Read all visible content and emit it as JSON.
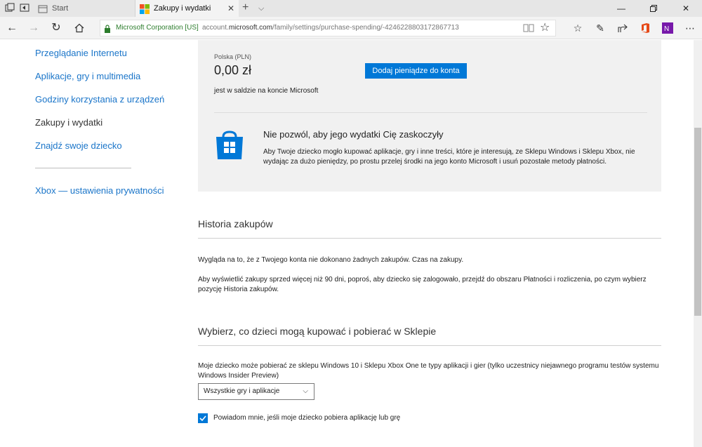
{
  "tabs": [
    {
      "label": "Start"
    },
    {
      "label": "Zakupy i wydatki"
    }
  ],
  "address": {
    "company": "Microsoft Corporation [US]",
    "url_prefix": "account.",
    "url_domain": "microsoft.com",
    "url_path": "/family/settings/purchase-spending/-4246228803172867713"
  },
  "sidebar": {
    "items": [
      {
        "label": "Przeglądanie Internetu"
      },
      {
        "label": "Aplikacje, gry i multimedia"
      },
      {
        "label": "Godziny korzystania z urządzeń"
      },
      {
        "label": "Zakupy i wydatki"
      },
      {
        "label": "Znajdź swoje dziecko"
      }
    ],
    "xbox": "Xbox — ustawienia prywatności"
  },
  "balance": {
    "currency_label": "Polska (PLN)",
    "amount": "0,00 zł",
    "add_button": "Dodaj pieniądze do konta",
    "note": "jest w saldzie na koncie Microsoft"
  },
  "promo": {
    "title": "Nie pozwól, aby jego wydatki Cię zaskoczyły",
    "body": "Aby Twoje dziecko mogło kupować aplikacje, gry i inne treści, które je interesują, ze Sklepu Windows i Sklepu Xbox, nie wydając za dużo pieniędzy, po prostu przelej środki na jego konto Microsoft i usuń pozostałe metody płatności."
  },
  "history": {
    "title": "Historia zakupów",
    "p1": "Wygląda na to, że z Twojego konta nie dokonano żadnych zakupów. Czas na zakupy.",
    "p2": "Aby wyświetlić zakupy sprzed więcej niż 90 dni, poproś, aby dziecko się zalogowało, przejdź do obszaru Płatności i rozliczenia, po czym wybierz pozycję Historia zakupów."
  },
  "store": {
    "title": "Wybierz, co dzieci mogą kupować i pobierać w Sklepie",
    "desc": "Moje dziecko może pobierać ze sklepu Windows 10 i Sklepu Xbox One te typy aplikacji i gier (tylko uczestnicy niejawnego programu testów systemu Windows Insider Preview)",
    "select_value": "Wszystkie gry i aplikacje",
    "notify_label": "Powiadom mnie, jeśli moje dziecko pobiera aplikację lub grę",
    "notify_checked": true
  },
  "colors": {
    "accent": "#0078d7",
    "link": "#1a75c9",
    "secure": "#2d7d2d"
  }
}
